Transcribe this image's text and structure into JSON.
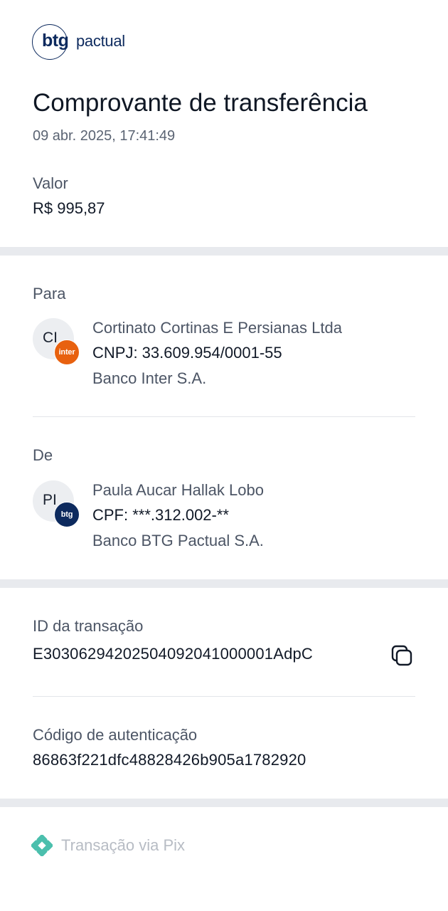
{
  "brand": {
    "logo_short": "btg",
    "logo_name": "pactual"
  },
  "header": {
    "title": "Comprovante de transferência",
    "datetime": "09 abr. 2025, 17:41:49"
  },
  "amount": {
    "label": "Valor",
    "value": "R$ 995,87"
  },
  "recipient": {
    "section_label": "Para",
    "initials": "CI",
    "bank_badge": "inter",
    "name": "Cortinato Cortinas E Persianas Ltda",
    "document": "CNPJ: 33.609.954/0001-55",
    "bank": "Banco Inter S.A."
  },
  "sender": {
    "section_label": "De",
    "initials": "PI",
    "bank_badge": "btg",
    "name": "Paula Aucar Hallak Lobo",
    "document": "CPF: ***.312.002-**",
    "bank": "Banco BTG Pactual S.A."
  },
  "transaction": {
    "id_label": "ID da transação",
    "id_value": "E30306294202504092041000001AdpC",
    "auth_label": "Código de autenticação",
    "auth_value": "86863f221dfc48828426b905a1782920"
  },
  "footer": {
    "pix_label": "Transação via Pix"
  },
  "colors": {
    "brand_navy": "#0d2a5e",
    "inter_orange": "#e8610f",
    "pix_teal": "#4bbfad",
    "separator_band": "#e8eaee"
  },
  "icons": {
    "copy": "copy-icon",
    "pix": "pix-icon"
  }
}
